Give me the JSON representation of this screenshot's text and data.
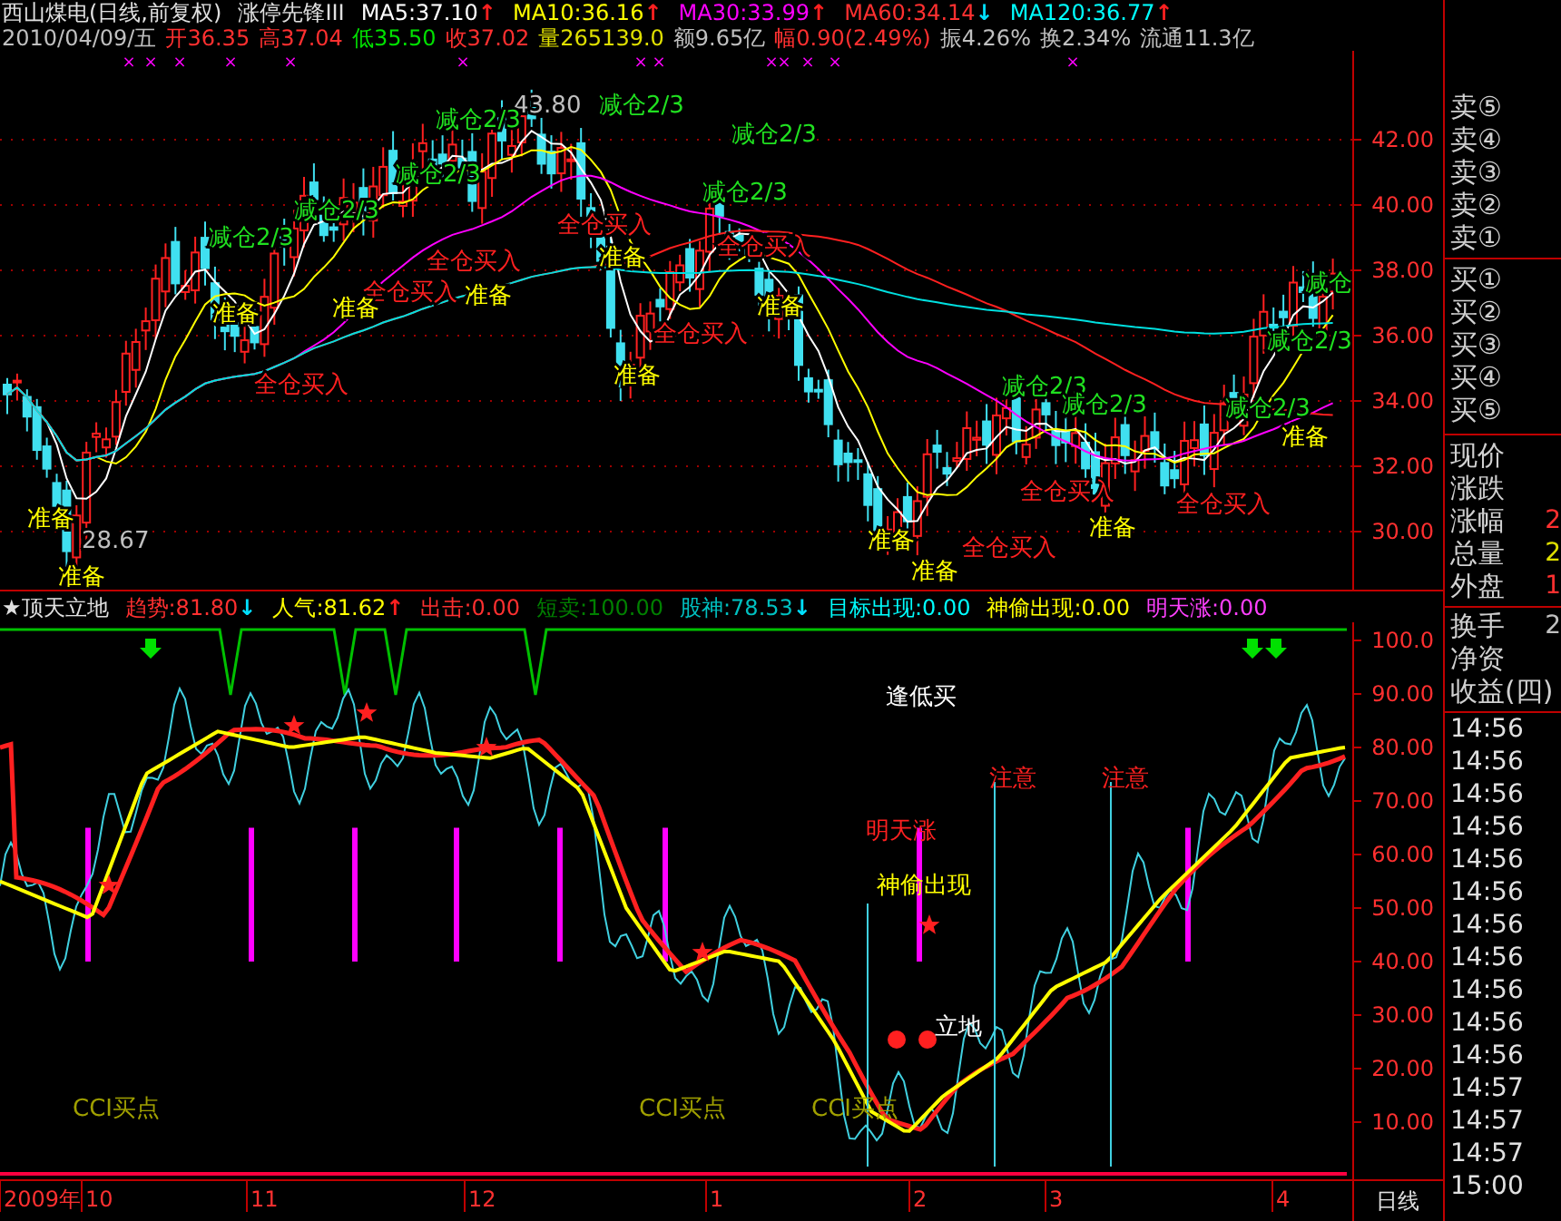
{
  "quote_header": {
    "title": "西山煤电(日线,前复权)",
    "indicator_name": "涨停先锋III",
    "mas": [
      {
        "label": "MA5:37.10",
        "color": "#ffffff",
        "arrow": {
          "text": "↑",
          "color": "#ff2020"
        }
      },
      {
        "label": "MA10:36.16",
        "color": "#ffff00",
        "arrow": {
          "text": "↑",
          "color": "#ff2020"
        }
      },
      {
        "label": "MA30:33.99",
        "color": "#ff00ff",
        "arrow": {
          "text": "↑",
          "color": "#ff2020"
        }
      },
      {
        "label": "MA60:34.14",
        "color": "#ff3030",
        "arrow": {
          "text": "↓",
          "color": "#00e0ff"
        }
      },
      {
        "label": "MA120:36.77",
        "color": "#00ffff",
        "arrow": {
          "text": "↑",
          "color": "#ff2020"
        }
      }
    ]
  },
  "quote_line": [
    {
      "text": "2010/04/09/五",
      "color": "#c0c0c0"
    },
    {
      "text": "开36.35",
      "color": "#ff3030"
    },
    {
      "text": "高37.04",
      "color": "#ff3030"
    },
    {
      "text": "低35.50",
      "color": "#00e000"
    },
    {
      "text": "收37.02",
      "color": "#ff3030"
    },
    {
      "text": "量265139.0",
      "color": "#e0e000"
    },
    {
      "text": "额9.65亿",
      "color": "#c0c0c0"
    },
    {
      "text": "幅0.90(2.49%)",
      "color": "#ff3030"
    },
    {
      "text": "振4.26%",
      "color": "#c0c0c0"
    },
    {
      "text": "换2.34%",
      "color": "#c0c0c0"
    },
    {
      "text": "流通11.3亿",
      "color": "#c0c0c0"
    }
  ],
  "main_chart": {
    "axis_labels": [
      "42.00",
      "40.00",
      "38.00",
      "36.00",
      "34.00",
      "32.00",
      "30.00"
    ],
    "markers": [
      "×",
      "×",
      "×",
      "×",
      "×",
      "×",
      "×",
      "×",
      "×",
      "×",
      "×",
      "×",
      "×"
    ],
    "annotations": [
      {
        "kind": "price",
        "text": "43.80"
      },
      {
        "kind": "reduce",
        "text": "减仓2/3"
      },
      {
        "kind": "reduce",
        "text": "减仓2/3"
      },
      {
        "kind": "reduce",
        "text": "减仓2/3"
      },
      {
        "kind": "reduce",
        "text": "减仓2/3"
      },
      {
        "kind": "reduce",
        "text": "减仓2/3"
      },
      {
        "kind": "reduce",
        "text": "减仓2/3"
      },
      {
        "kind": "buy",
        "text": "全仓买入"
      },
      {
        "kind": "reduce",
        "text": "减仓2/3"
      },
      {
        "kind": "buy",
        "text": "全仓买入"
      },
      {
        "kind": "buy",
        "text": "全仓买入"
      },
      {
        "kind": "ready",
        "text": "准备"
      },
      {
        "kind": "reduce",
        "text": "减仓"
      },
      {
        "kind": "buy",
        "text": "全仓买入"
      },
      {
        "kind": "ready",
        "text": "准备"
      },
      {
        "kind": "ready",
        "text": "准备"
      },
      {
        "kind": "ready",
        "text": "准备"
      },
      {
        "kind": "ready",
        "text": "准备"
      },
      {
        "kind": "reduce",
        "text": "减仓2/3"
      },
      {
        "kind": "buy",
        "text": "全仓买入"
      },
      {
        "kind": "ready",
        "text": "准备"
      },
      {
        "kind": "buy",
        "text": "全仓买入"
      },
      {
        "kind": "reduce",
        "text": "减仓2/3"
      },
      {
        "kind": "reduce",
        "text": "减仓2/3"
      },
      {
        "kind": "reduce",
        "text": "减仓2/3"
      },
      {
        "kind": "ready",
        "text": "准备"
      },
      {
        "kind": "buy",
        "text": "全仓买入"
      },
      {
        "kind": "buy",
        "text": "全仓买入"
      },
      {
        "kind": "ready",
        "text": "准备"
      },
      {
        "kind": "ready",
        "text": "准备"
      },
      {
        "kind": "price",
        "text": "28.67"
      },
      {
        "kind": "ready",
        "text": "准备"
      },
      {
        "kind": "buy",
        "text": "全仓买入"
      },
      {
        "kind": "ready",
        "text": "准备"
      },
      {
        "kind": "ready",
        "text": "准备"
      }
    ]
  },
  "indicator": {
    "items": [
      {
        "text": "★顶天立地",
        "color": "#e0e0e0"
      },
      {
        "text": "趋势:81.80",
        "color": "#ff3030",
        "arrow": {
          "text": "↓",
          "color": "#00e0ff"
        }
      },
      {
        "text": "人气:81.62",
        "color": "#ffff00",
        "arrow": {
          "text": "↑",
          "color": "#ff2020"
        }
      },
      {
        "text": "出击:0.00",
        "color": "#ff3030"
      },
      {
        "text": "短卖:100.00",
        "color": "#008000"
      },
      {
        "text": "股神:78.53",
        "color": "#00c0c0",
        "arrow": {
          "text": "↓",
          "color": "#00e0ff"
        }
      },
      {
        "text": "目标出现:0.00",
        "color": "#00ffff"
      },
      {
        "text": "神偷出现:0.00",
        "color": "#ffff00"
      },
      {
        "text": "明天涨:0.00",
        "color": "#ff40ff"
      }
    ],
    "axis_labels": [
      "100.0",
      "90.00",
      "80.00",
      "70.00",
      "60.00",
      "50.00",
      "40.00",
      "30.00",
      "20.00",
      "10.00"
    ],
    "annotations": [
      {
        "kind": "note",
        "text": "逢低买"
      },
      {
        "kind": "alert",
        "text": "明天涨"
      },
      {
        "kind": "alert",
        "text": "注意"
      },
      {
        "kind": "alert",
        "text": "注意"
      },
      {
        "kind": "thief",
        "text": "神偷出现"
      },
      {
        "kind": "note",
        "text": "立地"
      },
      {
        "kind": "cci",
        "text": "CCI买点"
      },
      {
        "kind": "cci",
        "text": "CCI买点"
      },
      {
        "kind": "cci",
        "text": "CCI买点"
      }
    ]
  },
  "time_axis": {
    "labels": [
      "2009年",
      "10",
      "11",
      "12",
      "1",
      "2",
      "3",
      "4"
    ],
    "period": "日线"
  },
  "order_book": {
    "asks": [
      "卖⑤",
      "卖④",
      "卖③",
      "卖②",
      "卖①"
    ],
    "bids": [
      "买①",
      "买②",
      "买③",
      "买④",
      "买⑤"
    ]
  },
  "stats": [
    {
      "label": "现价"
    },
    {
      "label": "涨跌"
    },
    {
      "label": "涨幅",
      "value": "2",
      "color": "#ff3030"
    },
    {
      "label": "总量",
      "value": "2",
      "color": "#e0e000"
    },
    {
      "label": "外盘",
      "value": "1",
      "color": "#ff3030"
    }
  ],
  "stats2": [
    {
      "label": "换手",
      "value": "2",
      "color": "#c0c0c0"
    },
    {
      "label": "净资"
    },
    {
      "label": "收益(四)"
    }
  ],
  "ticks": [
    "14:56",
    "14:56",
    "14:56",
    "14:56",
    "14:56",
    "14:56",
    "14:56",
    "14:56",
    "14:56",
    "14:56",
    "14:56",
    "14:57",
    "14:57",
    "14:57",
    "15:00"
  ]
}
